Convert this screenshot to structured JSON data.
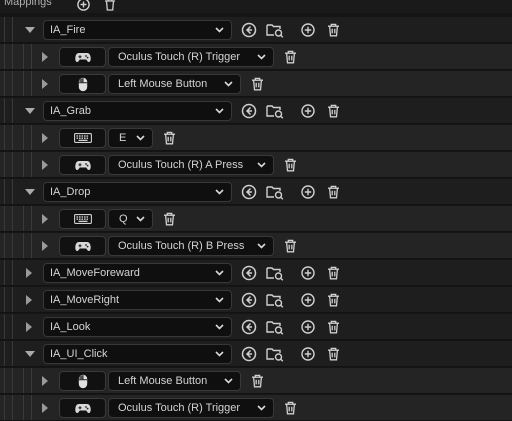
{
  "header": {
    "label": "Mappings",
    "add_icon": "plus-circle-icon",
    "delete_icon": "trash-icon"
  },
  "colors": {
    "background": "#151515",
    "row": "#1e1e1e",
    "child_row": "#242424",
    "field": "#0f0f0f",
    "text": "#d4d4d4"
  },
  "mappings": [
    {
      "action": "IA_Fire",
      "expanded": true,
      "keys": [
        {
          "device": "gamepad-icon",
          "key": "Oculus Touch (R) Trigger"
        },
        {
          "device": "mouse-icon",
          "key": "Left Mouse Button"
        }
      ]
    },
    {
      "action": "IA_Grab",
      "expanded": true,
      "keys": [
        {
          "device": "keyboard-icon",
          "key": "E"
        },
        {
          "device": "gamepad-icon",
          "key": "Oculus Touch (R) A Press"
        }
      ]
    },
    {
      "action": "IA_Drop",
      "expanded": true,
      "keys": [
        {
          "device": "keyboard-icon",
          "key": "Q"
        },
        {
          "device": "gamepad-icon",
          "key": "Oculus Touch (R) B Press"
        }
      ]
    },
    {
      "action": "IA_MoveForeward",
      "expanded": false,
      "keys": []
    },
    {
      "action": "IA_MoveRight",
      "expanded": false,
      "keys": []
    },
    {
      "action": "IA_Look",
      "expanded": false,
      "keys": []
    },
    {
      "action": "IA_UI_Click",
      "expanded": true,
      "keys": [
        {
          "device": "mouse-icon",
          "key": "Left Mouse Button"
        },
        {
          "device": "gamepad-icon",
          "key": "Oculus Touch (R) Trigger"
        }
      ]
    }
  ]
}
